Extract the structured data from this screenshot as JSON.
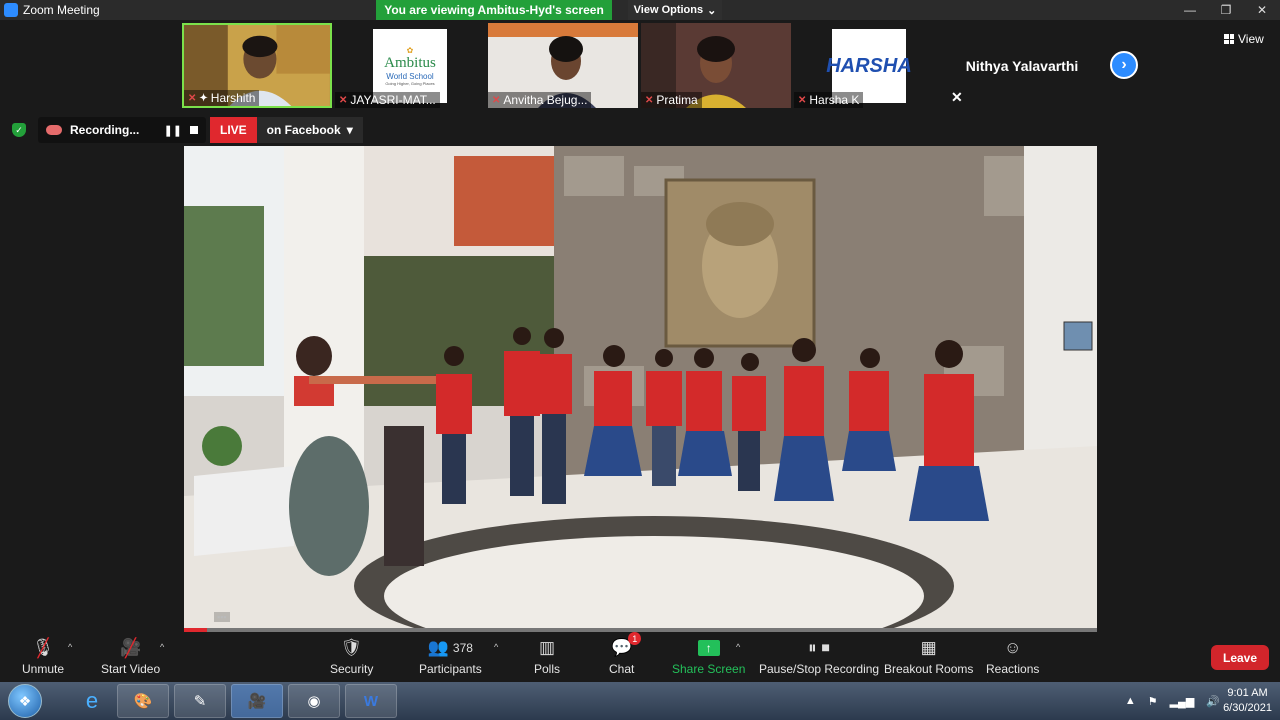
{
  "window": {
    "title": "Zoom Meeting",
    "minimize": "—",
    "restore": "❐",
    "close": "✕"
  },
  "banner": {
    "viewing_text": "You are viewing Ambitus-Hyd's screen",
    "view_options": "View Options"
  },
  "gallery": {
    "participants": [
      {
        "name": "Harshith",
        "active": true
      },
      {
        "name": "JAYASRI-MAT...",
        "logo_title": "Ambitus",
        "logo_sub": "World School",
        "logo_tagline": "Going Higher, Going Places"
      },
      {
        "name": "Anvitha Bejug..."
      },
      {
        "name": "Pratima"
      },
      {
        "name": "Harsha K",
        "logo_text": "HARSHA"
      },
      {
        "name": "Nithya Yalavarthi"
      }
    ],
    "view_label": "View"
  },
  "recording": {
    "label": "Recording...",
    "live": "LIVE",
    "destination": "on Facebook"
  },
  "share": {
    "progress": 0.025
  },
  "toolbar": {
    "unmute": "Unmute",
    "start_video": "Start Video",
    "security": "Security",
    "participants": "Participants",
    "participant_count": "378",
    "polls": "Polls",
    "chat": "Chat",
    "chat_badge": "1",
    "share_screen": "Share Screen",
    "recording": "Pause/Stop Recording",
    "breakout": "Breakout Rooms",
    "reactions": "Reactions",
    "leave": "Leave"
  },
  "taskbar": {
    "time": "9:01 AM",
    "date": "6/30/2021"
  }
}
